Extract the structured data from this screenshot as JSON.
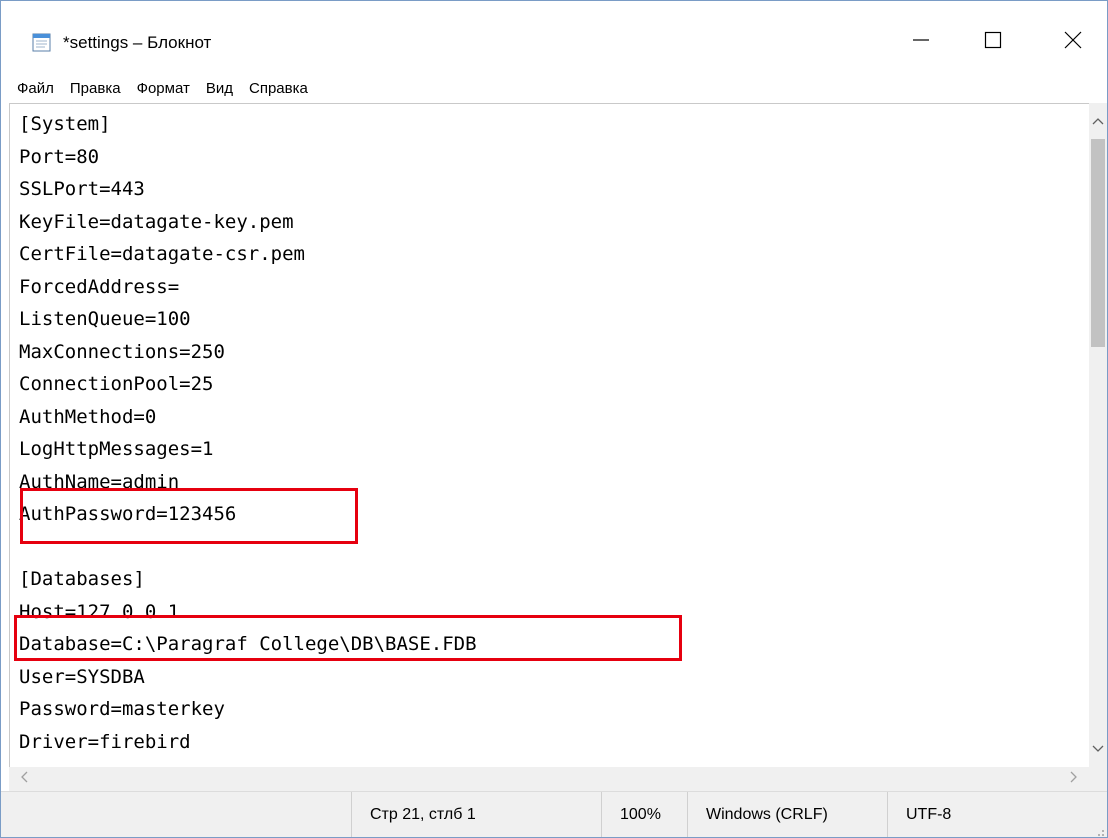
{
  "window": {
    "title": "*settings – Блокнот",
    "icon": "notepad-icon",
    "controls": {
      "minimize_icon": "minimize-icon",
      "maximize_icon": "maximize-icon",
      "close_icon": "close-icon"
    }
  },
  "menu": {
    "items": [
      {
        "label": "Файл"
      },
      {
        "label": "Правка"
      },
      {
        "label": "Формат"
      },
      {
        "label": "Вид"
      },
      {
        "label": "Справка"
      }
    ]
  },
  "editor": {
    "lines": [
      "[System]",
      "Port=80",
      "SSLPort=443",
      "KeyFile=datagate-key.pem",
      "CertFile=datagate-csr.pem",
      "ForcedAddress=",
      "ListenQueue=100",
      "MaxConnections=250",
      "ConnectionPool=25",
      "AuthMethod=0",
      "LogHttpMessages=1",
      "AuthName=admin",
      "AuthPassword=123456",
      "",
      "[Databases]",
      "Host=127.0.0.1",
      "Database=C:\\Paragraf College\\DB\\BASE.FDB",
      "User=SYSDBA",
      "Password=masterkey",
      "Driver=firebird"
    ],
    "highlight_color": "#e6000f"
  },
  "statusbar": {
    "position": "Стр 21, стлб 1",
    "zoom": "100%",
    "line_endings": "Windows (CRLF)",
    "encoding": "UTF-8"
  }
}
